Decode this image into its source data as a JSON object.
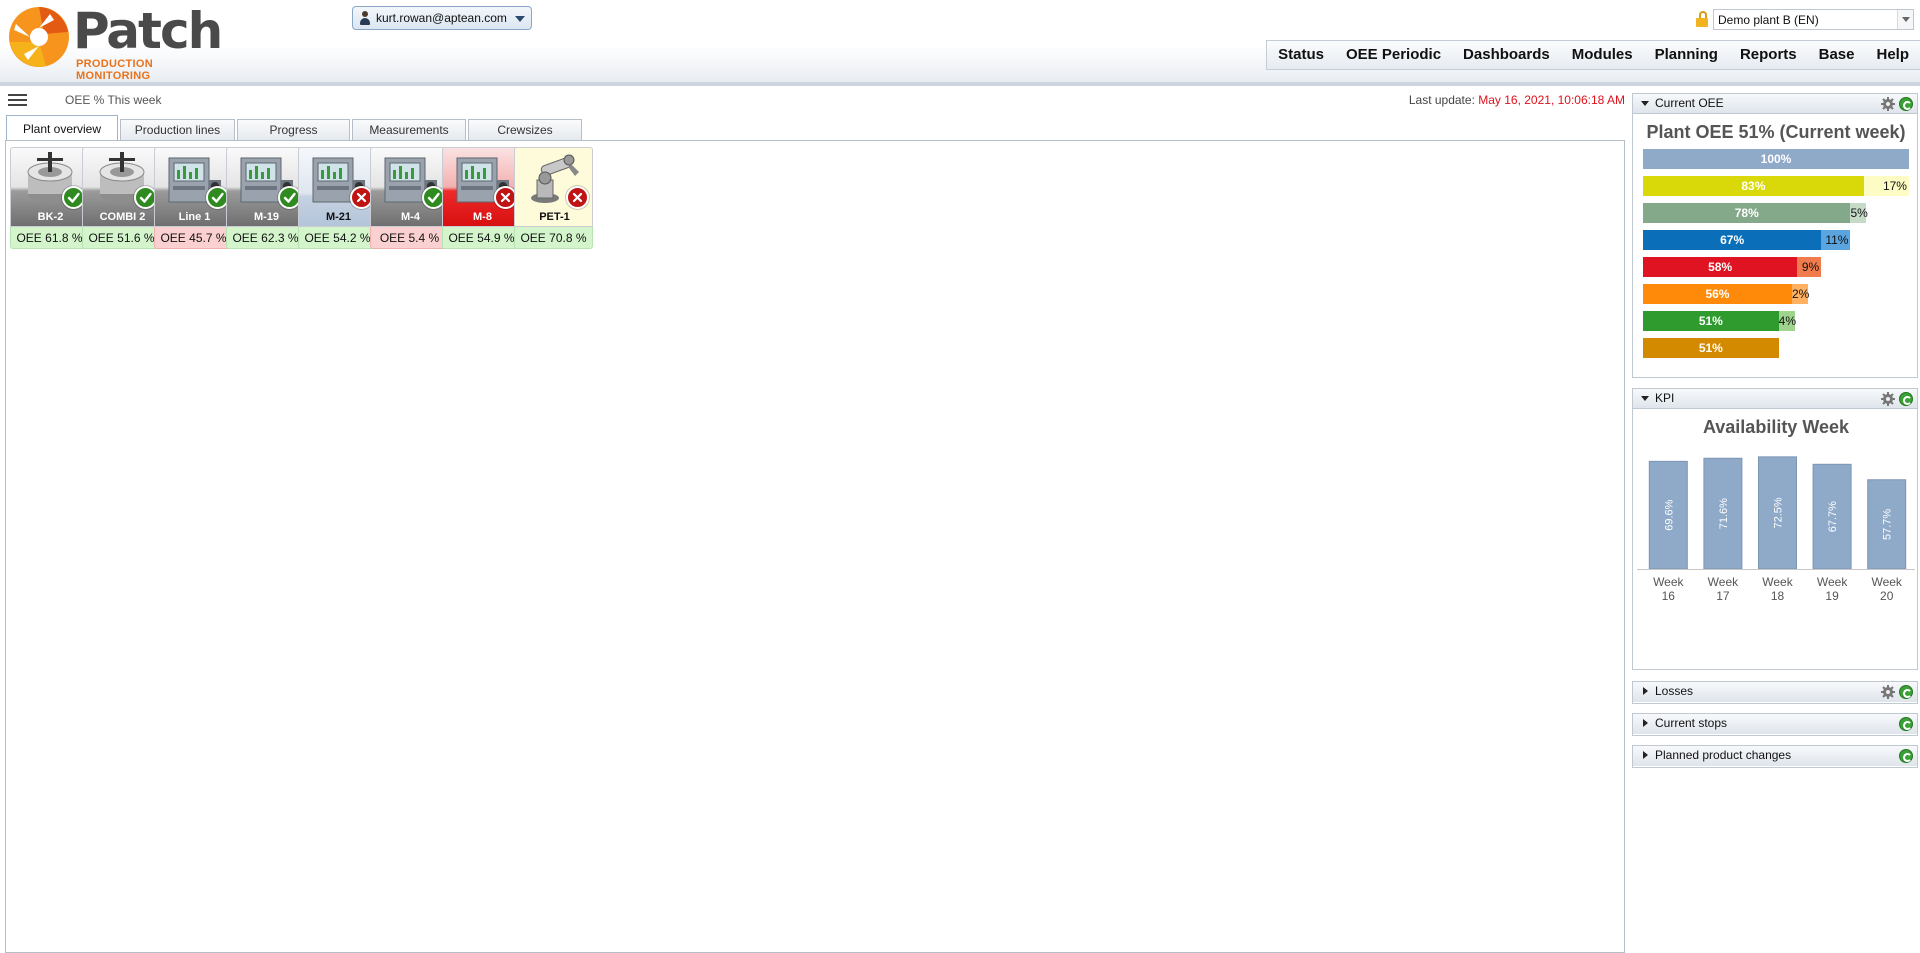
{
  "app": {
    "logo_text": "Patch",
    "logo_sub": "PRODUCTION MONITORING"
  },
  "header": {
    "user": "kurt.rowan@aptean.com",
    "plant": "Demo plant B (EN)",
    "nav": [
      "Status",
      "OEE Periodic",
      "Dashboards",
      "Modules",
      "Planning",
      "Reports",
      "Base",
      "Help"
    ]
  },
  "toolbar": {
    "period": "OEE % This week",
    "last_update_label": "Last update: ",
    "last_update_value": "May 16, 2021, 10:06:18 AM"
  },
  "tabs": [
    "Plant overview",
    "Production lines",
    "Progress",
    "Measurements",
    "Crewsizes"
  ],
  "machines": [
    {
      "name": "BK-2",
      "oee": "OEE 61.8 %",
      "status": "ok",
      "oee_state": "ok",
      "icon": "mixer-icon",
      "tile": "grey"
    },
    {
      "name": "COMBI 2",
      "oee": "OEE 51.6 %",
      "status": "ok",
      "oee_state": "ok",
      "icon": "mixer-icon",
      "tile": "grey"
    },
    {
      "name": "Line 1",
      "oee": "OEE 45.7 %",
      "status": "ok",
      "oee_state": "bad",
      "icon": "press-machine-icon",
      "tile": "grey"
    },
    {
      "name": "M-19",
      "oee": "OEE 62.3 %",
      "status": "ok",
      "oee_state": "ok",
      "icon": "press-machine-icon",
      "tile": "grey"
    },
    {
      "name": "M-21",
      "oee": "OEE 54.2 %",
      "status": "bad",
      "oee_state": "ok",
      "icon": "press-machine-icon",
      "tile": "blue"
    },
    {
      "name": "M-4",
      "oee": "OEE 5.4 %",
      "status": "ok",
      "oee_state": "bad",
      "icon": "press-machine-icon",
      "tile": "grey"
    },
    {
      "name": "M-8",
      "oee": "OEE 54.9 %",
      "status": "bad",
      "oee_state": "ok",
      "icon": "press-machine-icon",
      "tile": "red"
    },
    {
      "name": "PET-1",
      "oee": "OEE 70.8 %",
      "status": "bad",
      "oee_state": "ok",
      "icon": "robot-arm-icon",
      "tile": "yellow"
    }
  ],
  "panels": {
    "current_oee": {
      "label": "Current OEE",
      "title": "Plant OEE 51% (Current week)",
      "bars": [
        {
          "value": 100,
          "label": "100%",
          "rest": null,
          "rest_label": "",
          "color": "#8fa9c9",
          "rest_color": "#8fa9c9"
        },
        {
          "value": 83,
          "label": "83%",
          "rest": 17,
          "rest_label": "17%",
          "color": "#d9d90a",
          "rest_color": "#fcfcc4"
        },
        {
          "value": 78,
          "label": "78%",
          "rest": 5,
          "rest_label": "5%",
          "color": "#84a88a",
          "rest_color": "#c5dbc8"
        },
        {
          "value": 67,
          "label": "67%",
          "rest": 11,
          "rest_label": "11%",
          "color": "#0a6fb8",
          "rest_color": "#5aa4e0"
        },
        {
          "value": 58,
          "label": "58%",
          "rest": 9,
          "rest_label": "9%",
          "color": "#e01323",
          "rest_color": "#f07b4c"
        },
        {
          "value": 56,
          "label": "56%",
          "rest": 2,
          "rest_label": "2%",
          "color": "#ff8a0a",
          "rest_color": "#ffb060"
        },
        {
          "value": 51,
          "label": "51%",
          "rest": 4,
          "rest_label": "4%",
          "color": "#2f9b2f",
          "rest_color": "#9fd48e"
        },
        {
          "value": 51,
          "label": "51%",
          "rest": null,
          "rest_label": "",
          "color": "#d48a00",
          "rest_color": "#d48a00"
        }
      ]
    },
    "kpi": {
      "label": "KPI",
      "title": "Availability Week"
    },
    "losses": {
      "label": "Losses"
    },
    "current_stops": {
      "label": "Current stops"
    },
    "planned_changes": {
      "label": "Planned product changes"
    }
  },
  "chart_data": {
    "type": "bar",
    "title": "Availability Week",
    "categories": [
      "Week 16",
      "Week 17",
      "Week 18",
      "Week 19",
      "Week 20"
    ],
    "values": [
      69.6,
      71.6,
      72.5,
      67.7,
      57.7
    ],
    "value_labels": [
      "69.6%",
      "71.6%",
      "72.5%",
      "67.7%",
      "57.7%"
    ],
    "ylim": [
      0,
      75
    ],
    "bar_color": "#8fa9c9",
    "grid": false
  }
}
